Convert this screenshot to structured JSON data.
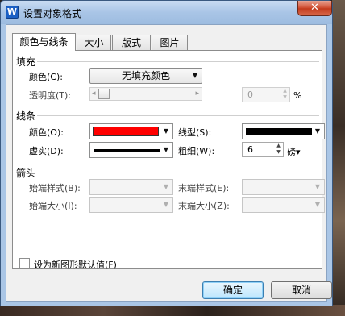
{
  "window": {
    "title": "设置对象格式",
    "app_icon_letter": "W",
    "close_glyph": "✕"
  },
  "tabs": [
    {
      "label": "颜色与线条"
    },
    {
      "label": "大小"
    },
    {
      "label": "版式"
    },
    {
      "label": "图片"
    }
  ],
  "fill": {
    "section_title": "填充",
    "color_label": "颜色(C):",
    "color_value": "无填充颜色",
    "transparency_label": "透明度(T):",
    "transparency_value": "0",
    "transparency_unit": "%",
    "transparency_slider": 0
  },
  "line": {
    "section_title": "线条",
    "color_label": "颜色(O):",
    "color_value": "#ff0000",
    "style_label": "线型(S):",
    "dash_label": "虚实(D):",
    "weight_label": "粗细(W):",
    "weight_value": "6",
    "weight_unit": "磅",
    "weight_unit_arrow": "▾"
  },
  "arrows": {
    "section_title": "箭头",
    "begin_style_label": "始端样式(B):",
    "end_style_label": "末端样式(E):",
    "begin_size_label": "始端大小(I):",
    "end_size_label": "末端大小(Z):"
  },
  "default_checkbox_label": "设为新图形默认值(F)",
  "buttons": {
    "ok": "确定",
    "cancel": "取消"
  },
  "icons": {
    "dropdown": "▼",
    "spin_up": "▲",
    "spin_down": "▼",
    "slider_left": "◂",
    "slider_right": "▸"
  }
}
